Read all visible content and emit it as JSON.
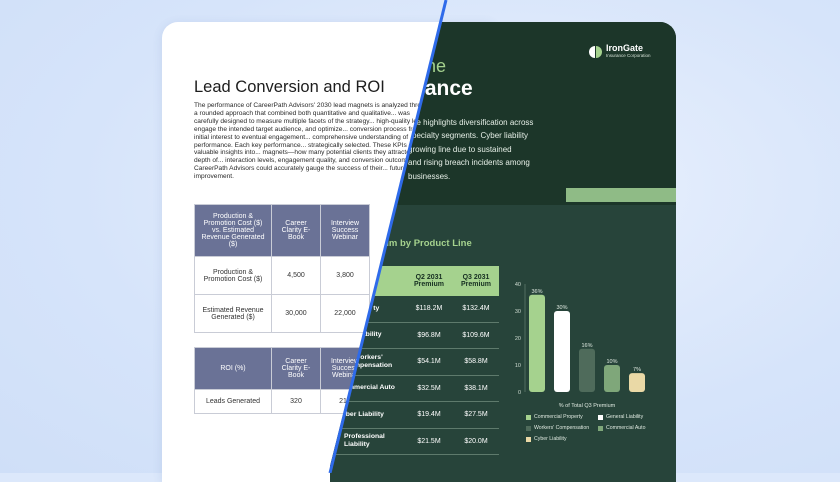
{
  "left_doc": {
    "title": "Lead Conversion and ROI",
    "paragraph": "The performance of CareerPath Advisors' 2030 lead magnets is analyzed through a rounded approach that combined both quantitative and qualitative... was carefully designed to measure multiple facets of the strategy... high-quality leads, engage the intended target audience, and optimize... conversion process from initial interest to eventual engagement... comprehensive understanding of performance. Each key performance... strategically selected. These KPIs offered valuable insights into... magnets—how many potential clients they attracted, the depth of... interaction levels, engagement quality, and conversion outcomes... CareerPath Advisors could accurately gauge the success of their... future improvement.",
    "table1": {
      "header": [
        "Production & Promotion Cost ($) vs. Estimated Revenue Generated ($)",
        "Career Clarity E-Book",
        "Interview Success Webinar"
      ],
      "rows": [
        [
          "Production & Promotion Cost ($)",
          "4,500",
          "3,800"
        ],
        [
          "Estimated Revenue Generated ($)",
          "30,000",
          "22,000"
        ]
      ]
    },
    "table2": {
      "header": [
        "ROI (%)",
        "Career Clarity E-Book",
        "Interview Success Webinar"
      ],
      "rows": [
        [
          "Leads Generated",
          "320",
          "210"
        ]
      ]
    }
  },
  "right_doc": {
    "logo_name": "IronGate",
    "logo_sub": "Insurance Corporation",
    "heading_light": "ine",
    "heading_bold": "nance",
    "paragraph_lines": [
      "nce highlights diversification across",
      "specialty segments. Cyber liability",
      "growing line due to sustained",
      "and rising breach incidents among",
      "businesses."
    ],
    "subhead": "mium by Product Line",
    "table": {
      "columns": [
        "ne",
        "Q2 2031 Premium",
        "Q3 2031 Premium"
      ],
      "rows": [
        {
          "line": "cial ty",
          "q2": "$118.2M",
          "q3": "$132.4M"
        },
        {
          "line": "iability",
          "q2": "$96.8M",
          "q3": "$109.6M"
        },
        {
          "line": "Workers' mpensation",
          "q2": "$54.1M",
          "q3": "$58.8M"
        },
        {
          "line": "mmercial Auto",
          "q2": "$32.5M",
          "q3": "$38.1M"
        },
        {
          "line": "yber Liability",
          "q2": "$19.4M",
          "q3": "$27.5M"
        },
        {
          "line": "Professional Liability",
          "q2": "$21.5M",
          "q3": "$20.0M"
        }
      ]
    }
  },
  "chart_data": {
    "type": "bar",
    "categories": [
      "Commercial Property",
      "General Liability",
      "Workers' Compensation",
      "Commercial Auto",
      "Cyber Liability"
    ],
    "values": [
      36,
      30,
      16,
      10,
      7
    ],
    "value_labels": [
      "36%",
      "30%",
      "16%",
      "10%",
      "7%"
    ],
    "colors": [
      "#a5d28e",
      "#ffffff",
      "#4f6b5b",
      "#7fa77a",
      "#ead9a6"
    ],
    "xlabel": "% of Total Q3 Premium",
    "ylabel": "",
    "ylim": [
      0,
      40
    ],
    "yticks": [
      0,
      10,
      20,
      30,
      40
    ],
    "grid": false,
    "legend": "bottom"
  }
}
